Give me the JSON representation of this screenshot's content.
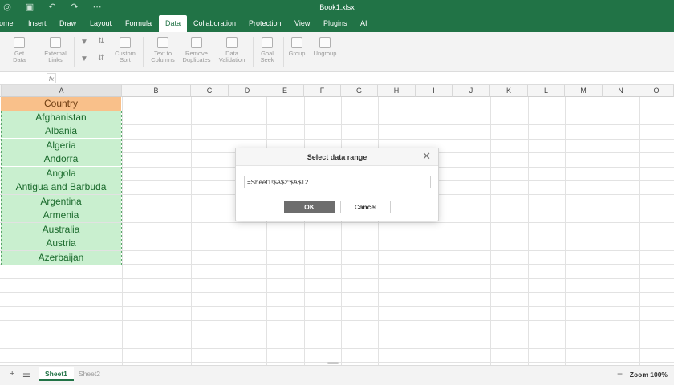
{
  "window": {
    "title": "Book1.xlsx"
  },
  "menu": {
    "tabs": [
      {
        "label": "ome"
      },
      {
        "label": "Insert"
      },
      {
        "label": "Draw"
      },
      {
        "label": "Layout"
      },
      {
        "label": "Formula"
      },
      {
        "label": "Data"
      },
      {
        "label": "Collaboration"
      },
      {
        "label": "Protection"
      },
      {
        "label": "View"
      },
      {
        "label": "Plugins"
      },
      {
        "label": "AI"
      }
    ],
    "active": "Data"
  },
  "ribbon": {
    "get_data": "Get\nData",
    "external_links": "External\nLinks",
    "custom_sort": "Custom\nSort",
    "text_to_columns": "Text to\nColumns",
    "remove_duplicates": "Remove\nDuplicates",
    "data_validation": "Data\nValidation",
    "goal_seek": "Goal\nSeek",
    "group": "Group",
    "ungroup": "Ungroup"
  },
  "formula_bar": {
    "fx": "fx",
    "name_box": "",
    "value": ""
  },
  "grid": {
    "columns": [
      "A",
      "B",
      "C",
      "D",
      "E",
      "F",
      "G",
      "H",
      "I",
      "J",
      "K",
      "L",
      "M",
      "N",
      "O"
    ],
    "selected_column": "A",
    "cells": {
      "header": "Country",
      "countries": [
        "Afghanistan",
        "Albania",
        "Algeria",
        "Andorra",
        "Angola",
        "Antigua and Barbuda",
        "Argentina",
        "Armenia",
        "Australia",
        "Austria",
        "Azerbaijan"
      ]
    }
  },
  "dialog": {
    "title": "Select data range",
    "range_value": "=Sheet1!$A$2:$A$12",
    "ok_label": "OK",
    "cancel_label": "Cancel"
  },
  "bottom": {
    "sheets": [
      {
        "label": "Sheet1"
      },
      {
        "label": "Sheet2"
      }
    ],
    "zoom": "Zoom 100%"
  },
  "colors": {
    "accent": "#217346",
    "header_fill": "#f9c08a",
    "data_fill": "#c9efcf"
  }
}
